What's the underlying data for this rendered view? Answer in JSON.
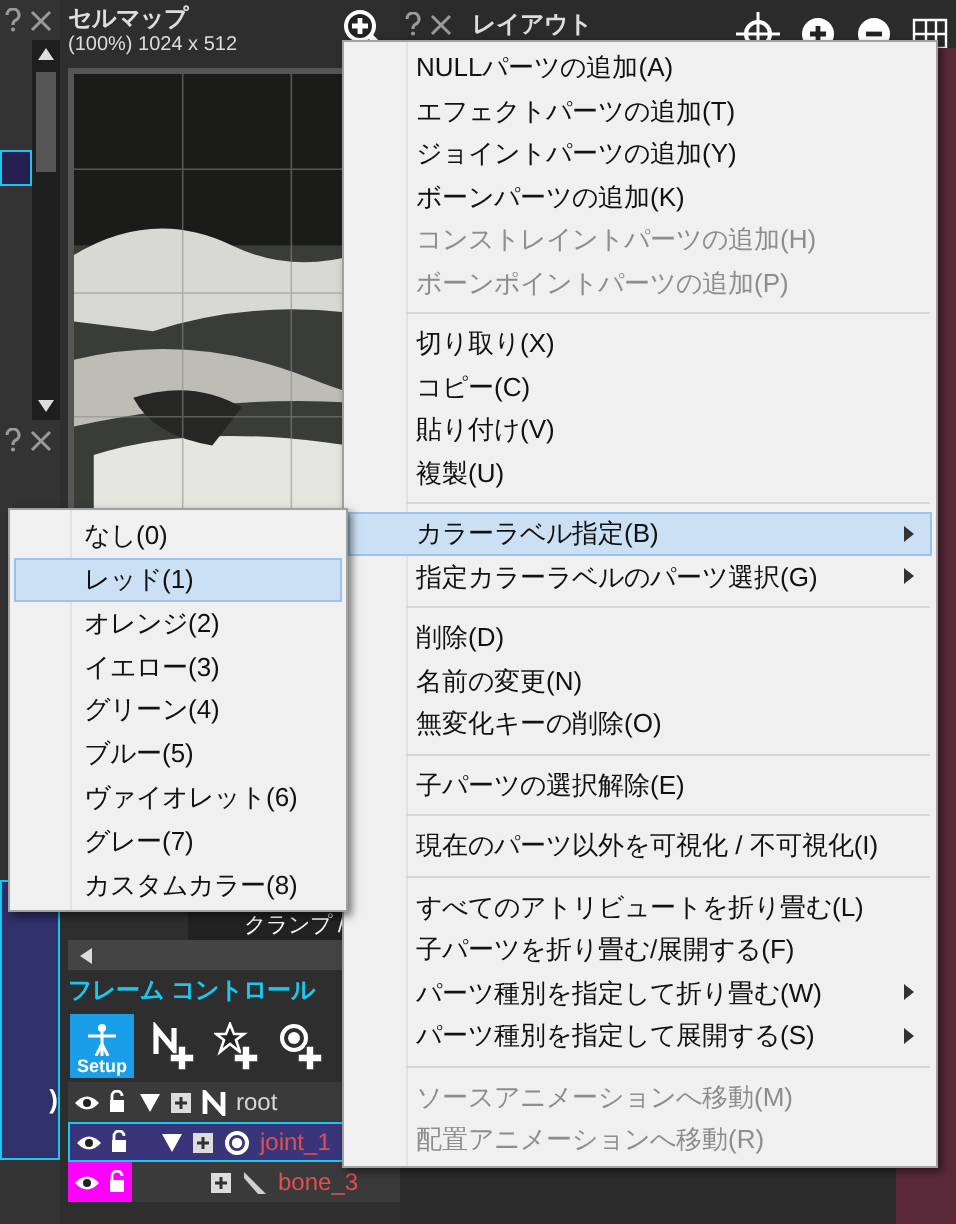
{
  "cellmap": {
    "title": "セルマップ",
    "info": "(100%) 1024 x 512"
  },
  "layout_panel": {
    "title": "レイアウト"
  },
  "left_panel": {
    "label": ")"
  },
  "clamp_label": "クランプ /",
  "frame_control": {
    "title": "フレーム コントロール",
    "setup_label": "Setup",
    "tree": [
      {
        "name": "root",
        "kind": "null",
        "selected": false,
        "highlighted": false,
        "children": [
          {
            "name": "joint_1",
            "kind": "joint",
            "selected": true,
            "highlighted": false,
            "children": [
              {
                "name": "bone_3",
                "kind": "bone",
                "selected": false,
                "highlighted": true
              }
            ]
          }
        ]
      }
    ]
  },
  "context_menu": {
    "sections": [
      {
        "items": [
          {
            "label": "NULLパーツの追加(A)",
            "disabled": false,
            "submenu": false,
            "selected": false
          },
          {
            "label": "エフェクトパーツの追加(T)",
            "disabled": false,
            "submenu": false,
            "selected": false
          },
          {
            "label": "ジョイントパーツの追加(Y)",
            "disabled": false,
            "submenu": false,
            "selected": false
          },
          {
            "label": "ボーンパーツの追加(K)",
            "disabled": false,
            "submenu": false,
            "selected": false
          },
          {
            "label": "コンストレイントパーツの追加(H)",
            "disabled": true,
            "submenu": false,
            "selected": false
          },
          {
            "label": "ボーンポイントパーツの追加(P)",
            "disabled": true,
            "submenu": false,
            "selected": false
          }
        ]
      },
      {
        "items": [
          {
            "label": "切り取り(X)",
            "disabled": false,
            "submenu": false,
            "selected": false
          },
          {
            "label": "コピー(C)",
            "disabled": false,
            "submenu": false,
            "selected": false
          },
          {
            "label": "貼り付け(V)",
            "disabled": false,
            "submenu": false,
            "selected": false
          },
          {
            "label": "複製(U)",
            "disabled": false,
            "submenu": false,
            "selected": false
          }
        ]
      },
      {
        "items": [
          {
            "label": "カラーラベル指定(B)",
            "disabled": false,
            "submenu": true,
            "selected": true
          },
          {
            "label": "指定カラーラベルのパーツ選択(G)",
            "disabled": false,
            "submenu": true,
            "selected": false
          }
        ]
      },
      {
        "items": [
          {
            "label": "削除(D)",
            "disabled": false,
            "submenu": false,
            "selected": false
          },
          {
            "label": "名前の変更(N)",
            "disabled": false,
            "submenu": false,
            "selected": false
          },
          {
            "label": "無変化キーの削除(O)",
            "disabled": false,
            "submenu": false,
            "selected": false
          }
        ]
      },
      {
        "items": [
          {
            "label": "子パーツの選択解除(E)",
            "disabled": false,
            "submenu": false,
            "selected": false
          }
        ]
      },
      {
        "items": [
          {
            "label": "現在のパーツ以外を可視化 / 不可視化(I)",
            "disabled": false,
            "submenu": false,
            "selected": false
          }
        ]
      },
      {
        "items": [
          {
            "label": "すべてのアトリビュートを折り畳む(L)",
            "disabled": false,
            "submenu": false,
            "selected": false
          },
          {
            "label": "子パーツを折り畳む/展開する(F)",
            "disabled": false,
            "submenu": false,
            "selected": false
          },
          {
            "label": "パーツ種別を指定して折り畳む(W)",
            "disabled": false,
            "submenu": true,
            "selected": false
          },
          {
            "label": "パーツ種別を指定して展開する(S)",
            "disabled": false,
            "submenu": true,
            "selected": false
          }
        ]
      },
      {
        "items": [
          {
            "label": "ソースアニメーションへ移動(M)",
            "disabled": true,
            "submenu": false,
            "selected": false
          },
          {
            "label": "配置アニメーションへ移動(R)",
            "disabled": true,
            "submenu": false,
            "selected": false
          }
        ]
      }
    ]
  },
  "color_submenu": {
    "items": [
      {
        "label": "なし(0)",
        "selected": false
      },
      {
        "label": "レッド(1)",
        "selected": true
      },
      {
        "label": "オレンジ(2)",
        "selected": false
      },
      {
        "label": "イエロー(3)",
        "selected": false
      },
      {
        "label": "グリーン(4)",
        "selected": false
      },
      {
        "label": "ブルー(5)",
        "selected": false
      },
      {
        "label": "ヴァイオレット(6)",
        "selected": false
      },
      {
        "label": "グレー(7)",
        "selected": false
      },
      {
        "label": "カスタムカラー(8)",
        "selected": false
      }
    ]
  }
}
